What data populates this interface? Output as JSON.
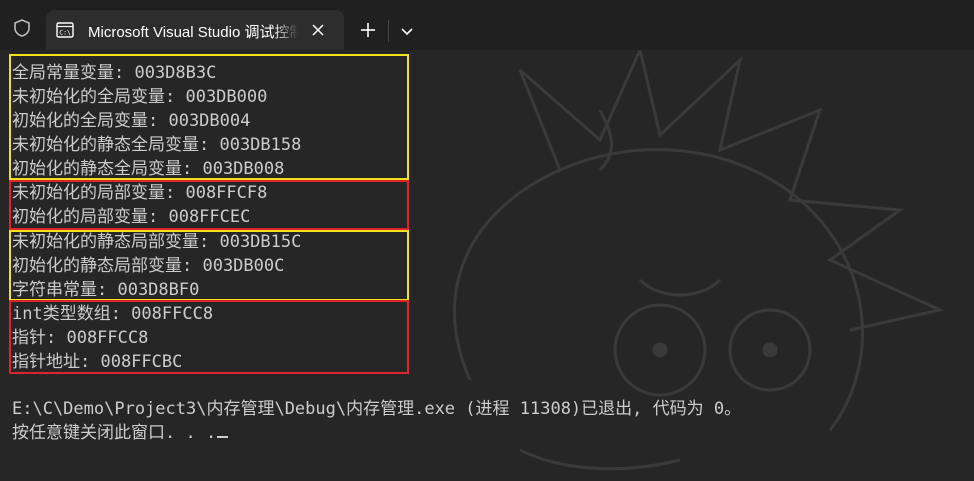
{
  "titlebar": {
    "shield_icon": "shield-icon",
    "tab_icon": "console-app-icon",
    "tab_title": "Microsoft Visual Studio 调试控制台",
    "new_tab_icon": "plus-icon",
    "dropdown_icon": "chevron-down-icon",
    "close_icon": "close-icon"
  },
  "console": {
    "lines": [
      "全局常量变量: 003D8B3C",
      "未初始化的全局变量: 003DB000",
      "初始化的全局变量: 003DB004",
      "未初始化的静态全局变量: 003DB158",
      "初始化的静态全局变量: 003DB008",
      "未初始化的局部变量: 008FFCF8",
      "初始化的局部变量: 008FFCEC",
      "未初始化的静态局部变量: 003DB15C",
      "初始化的静态局部变量: 003DB00C",
      "字符串常量: 003D8BF0",
      "int类型数组: 008FFCC8",
      "指针: 008FFCC8",
      "指针地址: 008FFCBC"
    ],
    "exit_line": "E:\\C\\Demo\\Project3\\内存管理\\Debug\\内存管理.exe (进程 11308)已退出, 代码为 0。",
    "prompt_line": "按任意键关闭此窗口. . ."
  },
  "colors": {
    "highlight_yellow": "#f3e21b",
    "highlight_red": "#e0242c",
    "console_text": "#cccccc",
    "background": "#262626"
  }
}
